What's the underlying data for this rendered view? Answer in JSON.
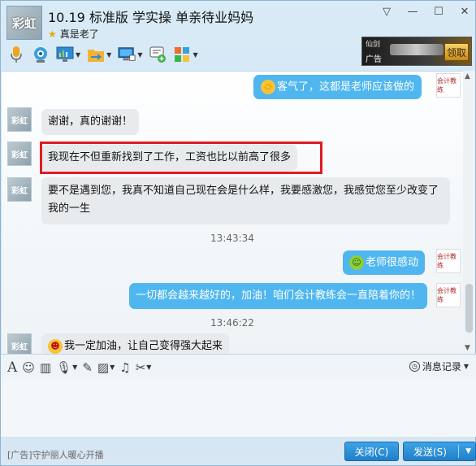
{
  "header": {
    "avatar_text": "彩虹",
    "title": "10.19 标准版 学实操 单亲待业妈妈",
    "status": "真是老了",
    "controls": {
      "menu": "▽",
      "minimize": "—",
      "maximize": "☐",
      "close": "✕"
    }
  },
  "toolbar": {
    "items": [
      {
        "icon": "microphone-icon"
      },
      {
        "icon": "video-camera-icon"
      },
      {
        "icon": "screen-share-icon"
      },
      {
        "icon": "file-transfer-icon"
      },
      {
        "icon": "remote-desktop-icon"
      },
      {
        "icon": "invite-icon"
      },
      {
        "icon": "app-grid-icon"
      }
    ]
  },
  "ad_banner": {
    "top": "仙剑",
    "tag": "广告",
    "button": "领取"
  },
  "chat": {
    "messages": [
      {
        "side": "right",
        "emoji": true,
        "text": "客气了，这都是老师应该做的"
      },
      {
        "side": "left",
        "text": "谢谢，真的谢谢！"
      },
      {
        "side": "left",
        "text": "我现在不但重新找到了工作，工资也比以前高了很多"
      },
      {
        "side": "left",
        "text": "要不是遇到您，我真不知道自己现在会是什么样，我要感激您，我感觉您至少改变了我的一生"
      },
      {
        "side": "time",
        "text": "13:43:34"
      },
      {
        "side": "right",
        "emoji": true,
        "text": "老师很感动"
      },
      {
        "side": "right",
        "text": "一切都会越来越好的，加油！咱们会计教练会一直陪着你的！"
      },
      {
        "side": "time",
        "text": "13:46:22"
      },
      {
        "side": "left",
        "emoji": true,
        "text": "我一定加油，让自己变得强大起来"
      }
    ],
    "left_avatar_text": "彩虹",
    "right_avatar_text": "会计教练"
  },
  "input_toolbar": {
    "history_label": "消息记录"
  },
  "bottom": {
    "ad_text": "[广告]守护丽人暖心开播",
    "close_label": "关闭(C)",
    "send_label": "发送(S)"
  },
  "colors": {
    "right_bubble": "#4fb6ef",
    "left_bubble": "#e7ebee",
    "highlight": "#e11b22",
    "button": "#2a8fd8"
  }
}
